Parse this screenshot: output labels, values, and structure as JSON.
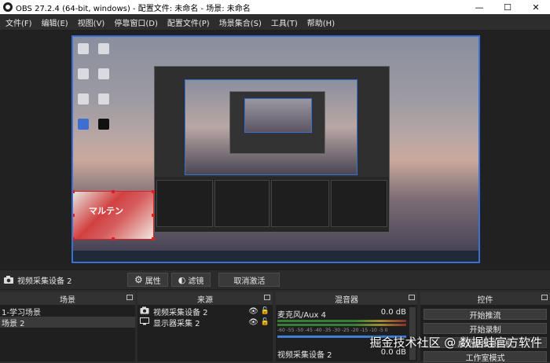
{
  "window": {
    "title": "OBS 27.2.4 (64-bit, windows) - 配置文件: 未命名 - 场景: 未命名",
    "minimize": "—",
    "maximize": "☐",
    "close": "✕"
  },
  "menu": [
    "文件(F)",
    "编辑(E)",
    "视图(V)",
    "停靠窗口(D)",
    "配置文件(P)",
    "场景集合(S)",
    "工具(T)",
    "帮助(H)"
  ],
  "preview": {
    "cam_overlay_text": "マルテン"
  },
  "source_toolbar": {
    "selected_source": "视频采集设备 2",
    "properties": "属性",
    "filters": "滤镜",
    "deactivate": "取消激活"
  },
  "docks": {
    "scenes": {
      "title": "场景",
      "items": [
        "1-学习场景",
        "场景 2"
      ],
      "selected_index": 1
    },
    "sources": {
      "title": "来源",
      "items": [
        {
          "name": "视频采集设备 2",
          "icon": "camera-icon"
        },
        {
          "name": "显示器采集 2",
          "icon": "monitor-icon"
        }
      ]
    },
    "mixer": {
      "title": "混音器",
      "channels": [
        {
          "name": "麦克风/Aux 4",
          "db": "0.0 dB"
        },
        {
          "name": "视频采集设备 2",
          "db": "0.0 dB"
        }
      ],
      "scale": "-60 -55 -50 -45 -40 -35 -30 -25 -20 -15 -10 -5 0"
    },
    "controls": {
      "title": "控件",
      "buttons": [
        "开始推流",
        "开始录制",
        "启动虚拟摄像机",
        "工作室模式"
      ]
    }
  },
  "watermark": "掘金技术社区 @ 数据蛙官方软件",
  "colors": {
    "selection_border": "#3b6fd6",
    "source_handle": "#e02020"
  }
}
